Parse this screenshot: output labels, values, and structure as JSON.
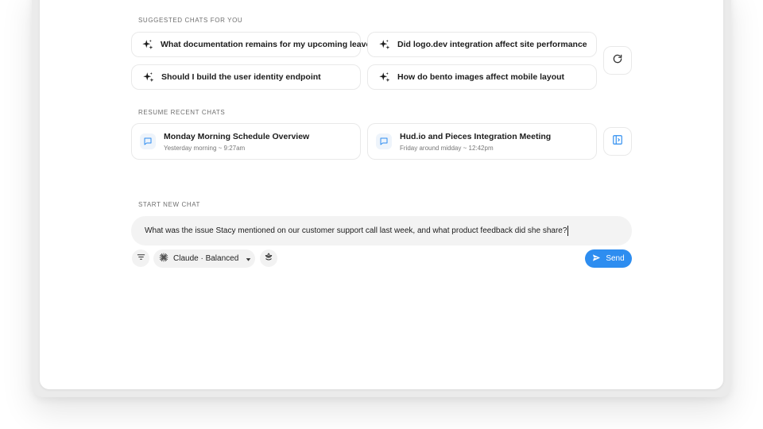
{
  "suggested": {
    "label": "SUGGESTED CHATS FOR YOU",
    "items": [
      {
        "text": "What documentation remains for my upcoming leave",
        "icon": "sparkle-icon"
      },
      {
        "text": "Did logo.dev integration affect site performance",
        "icon": "sparkle-icon"
      },
      {
        "text": "Should I build the user identity endpoint",
        "icon": "sparkle-icon"
      },
      {
        "text": "How do bento images affect mobile layout",
        "icon": "sparkle-icon"
      }
    ],
    "refresh_icon": "refresh-icon"
  },
  "resume": {
    "label": "RESUME RECENT CHATS",
    "items": [
      {
        "title": "Monday Morning Schedule Overview",
        "subtitle": "Yesterday morning ~ 9:27am",
        "icon": "chat-bubble-icon"
      },
      {
        "title": "Hud.io and Pieces Integration Meeting",
        "subtitle": "Friday around midday ~ 12:42pm",
        "icon": "chat-bubble-icon"
      }
    ],
    "open_panel_icon": "sidebar-panel-icon"
  },
  "new_chat": {
    "label": "START NEW CHAT",
    "input_value": "What was the issue Stacy mentioned on our customer support call last week, and what product feedback did she share?",
    "filter_icon": "filter-icon",
    "model_label": "Claude · Balanced",
    "model_icon": "claude-starburst-icon",
    "extra_icon": "lotus-icon",
    "send_label": "Send",
    "send_icon": "paper-plane-icon"
  },
  "colors": {
    "accent": "#2d8df0",
    "chat_icon_bg": "#eef4fb",
    "input_bg": "#f3f3f3"
  }
}
